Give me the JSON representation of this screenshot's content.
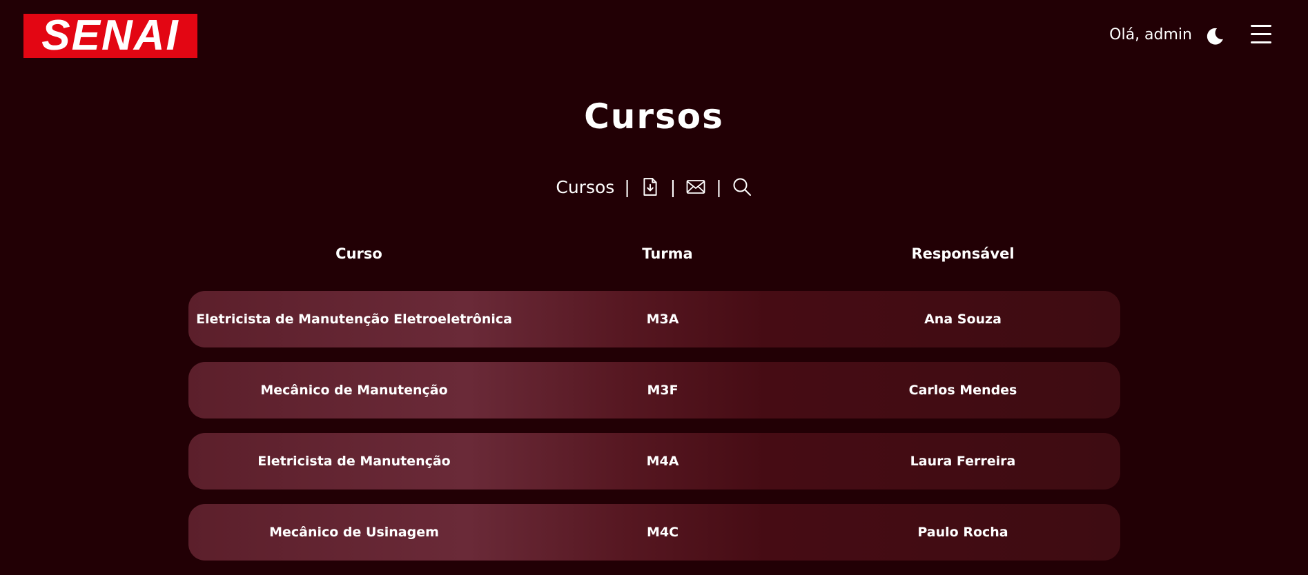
{
  "header": {
    "logo_text": "SENAI",
    "greeting": "Olá, admin",
    "theme_icon": "moon-icon",
    "menu_icon": "hamburger-menu-icon"
  },
  "page": {
    "title": "Cursos"
  },
  "toolbar": {
    "label": "Cursos",
    "separator": "|",
    "icons": [
      "file-download-icon",
      "envelope-icon",
      "search-icon"
    ]
  },
  "table": {
    "columns": [
      "Curso",
      "Turma",
      "Responsável"
    ],
    "rows": [
      {
        "curso": "Eletricista de Manutenção Eletroeletrônica",
        "turma": "M3A",
        "responsavel": "Ana Souza"
      },
      {
        "curso": "Mecânico de Manutenção",
        "turma": "M3F",
        "responsavel": "Carlos Mendes"
      },
      {
        "curso": "Eletricista de Manutenção",
        "turma": "M4A",
        "responsavel": "Laura Ferreira"
      },
      {
        "curso": "Mecânico de Usinagem",
        "turma": "M4C",
        "responsavel": "Paulo Rocha"
      }
    ]
  },
  "colors": {
    "background": "#220005",
    "logo_red": "#e30613",
    "row_gradient_start": "#5c1f2b",
    "row_gradient_end": "#3e0c12",
    "text": "#ffffff"
  }
}
